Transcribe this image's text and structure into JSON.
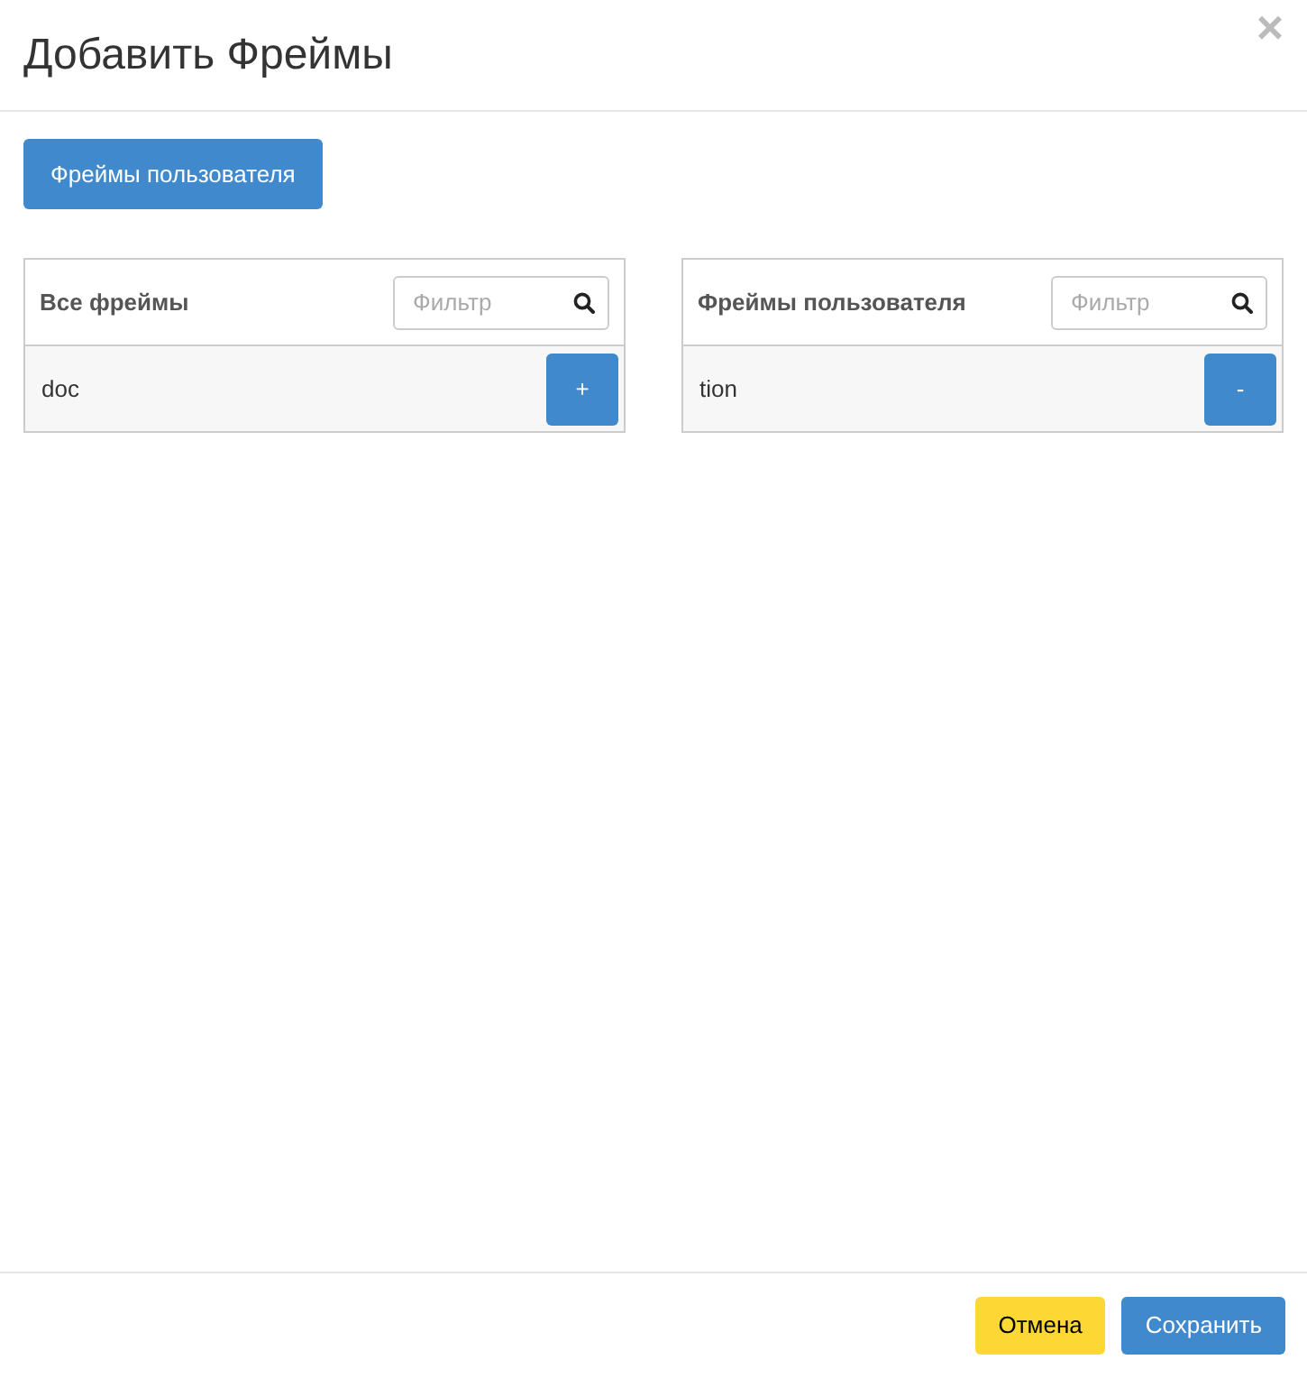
{
  "dialog": {
    "title": "Добавить Фреймы",
    "close": "×"
  },
  "tab_button": {
    "label": "Фреймы пользователя"
  },
  "panels": [
    {
      "title": "Все фреймы",
      "filter_placeholder": "Фильтр",
      "items": [
        {
          "name": "doc",
          "action": "+"
        }
      ]
    },
    {
      "title": "Фреймы пользователя",
      "filter_placeholder": "Фильтр",
      "items": [
        {
          "name": "tion",
          "action": "-"
        }
      ]
    }
  ],
  "footer": {
    "buttons": [
      {
        "label": "Отмена",
        "kind": "cancel"
      },
      {
        "label": "Сохранить",
        "kind": "primary"
      }
    ]
  }
}
